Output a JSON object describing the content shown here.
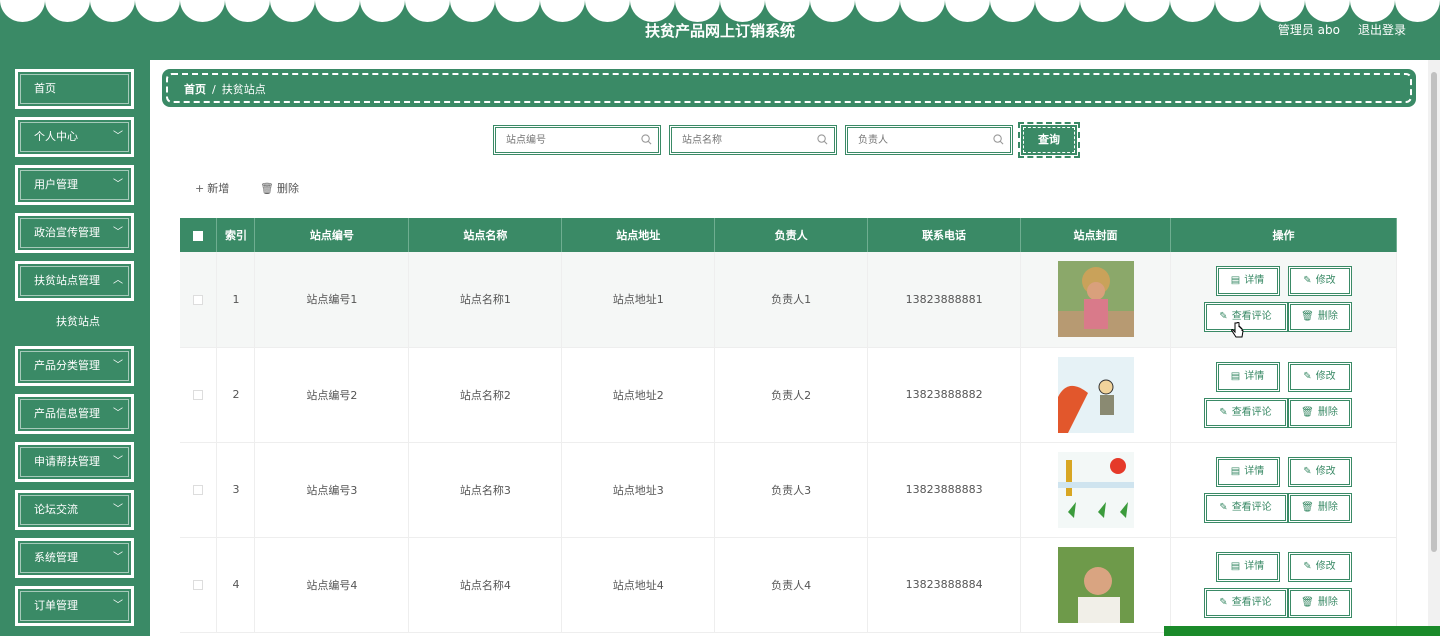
{
  "header": {
    "title": "扶贫产品网上订销系统",
    "user": "管理员 abo",
    "logout": "退出登录"
  },
  "sidebar": {
    "items": [
      {
        "label": "首页",
        "chevron": false
      },
      {
        "label": "个人中心",
        "chevron": true
      },
      {
        "label": "用户管理",
        "chevron": true
      },
      {
        "label": "政治宣传管理",
        "chevron": true
      },
      {
        "label": "扶贫站点管理",
        "chevron": true
      },
      {
        "label": "产品分类管理",
        "chevron": true
      },
      {
        "label": "产品信息管理",
        "chevron": true
      },
      {
        "label": "申请帮扶管理",
        "chevron": true
      },
      {
        "label": "论坛交流",
        "chevron": true
      },
      {
        "label": "系统管理",
        "chevron": true
      },
      {
        "label": "订单管理",
        "chevron": true
      }
    ],
    "submenu": "扶贫站点"
  },
  "breadcrumb": {
    "home": "首页",
    "sep": "/",
    "current": "扶贫站点"
  },
  "search": {
    "station_no_placeholder": "站点编号",
    "station_name_placeholder": "站点名称",
    "manager_placeholder": "负责人",
    "query": "查询"
  },
  "toolbar": {
    "add": "新增",
    "delete": "删除"
  },
  "table": {
    "headers": [
      "索引",
      "站点编号",
      "站点名称",
      "站点地址",
      "负责人",
      "联系电话",
      "站点封面",
      "操作"
    ],
    "rows": [
      {
        "index": "1",
        "no": "站点编号1",
        "name": "站点名称1",
        "addr": "站点地址1",
        "manager": "负责人1",
        "phone": "13823888881"
      },
      {
        "index": "2",
        "no": "站点编号2",
        "name": "站点名称2",
        "addr": "站点地址2",
        "manager": "负责人2",
        "phone": "13823888882"
      },
      {
        "index": "3",
        "no": "站点编号3",
        "name": "站点名称3",
        "addr": "站点地址3",
        "manager": "负责人3",
        "phone": "13823888883"
      },
      {
        "index": "4",
        "no": "站点编号4",
        "name": "站点名称4",
        "addr": "站点地址4",
        "manager": "负责人4",
        "phone": "13823888884"
      }
    ],
    "ops": {
      "detail": "详情",
      "edit": "修改",
      "comments": "查看评论",
      "delete": "删除"
    }
  },
  "colors": {
    "primary": "#3a8a66",
    "white": "#ffffff"
  }
}
